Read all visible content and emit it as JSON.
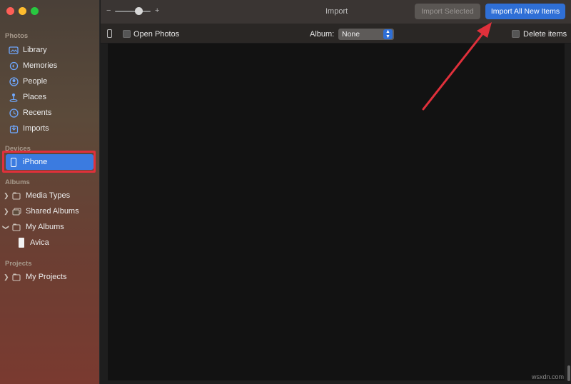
{
  "window": {
    "title": "Import"
  },
  "sidebar": {
    "sections": {
      "photos": "Photos",
      "devices": "Devices",
      "albums": "Albums",
      "projects": "Projects"
    },
    "photos_items": [
      {
        "label": "Library",
        "icon": "library-icon"
      },
      {
        "label": "Memories",
        "icon": "memories-icon"
      },
      {
        "label": "People",
        "icon": "people-icon"
      },
      {
        "label": "Places",
        "icon": "places-icon"
      },
      {
        "label": "Recents",
        "icon": "recents-icon"
      },
      {
        "label": "Imports",
        "icon": "imports-icon"
      }
    ],
    "device": {
      "label": "iPhone",
      "icon": "iphone-icon"
    },
    "album_items": [
      {
        "label": "Media Types",
        "icon": "folder-icon"
      },
      {
        "label": "Shared Albums",
        "icon": "shared-albums-icon"
      },
      {
        "label": "My Albums",
        "icon": "folder-icon"
      },
      {
        "label": "Avica",
        "icon": "album-thumb-icon"
      }
    ],
    "project_items": [
      {
        "label": "My Projects",
        "icon": "folder-icon"
      }
    ]
  },
  "toolbar": {
    "zoom_minus": "−",
    "zoom_plus": "+",
    "import_selected_label": "Import Selected",
    "import_all_label": "Import All New Items"
  },
  "subbar": {
    "open_photos_label": "Open Photos",
    "album_label": "Album:",
    "album_value": "None",
    "delete_items_label": "Delete items"
  },
  "watermark": "wsxdn.com",
  "colors": {
    "accent": "#2f6fd6",
    "selection": "#3b7be0",
    "annotation": "#e0303b"
  }
}
